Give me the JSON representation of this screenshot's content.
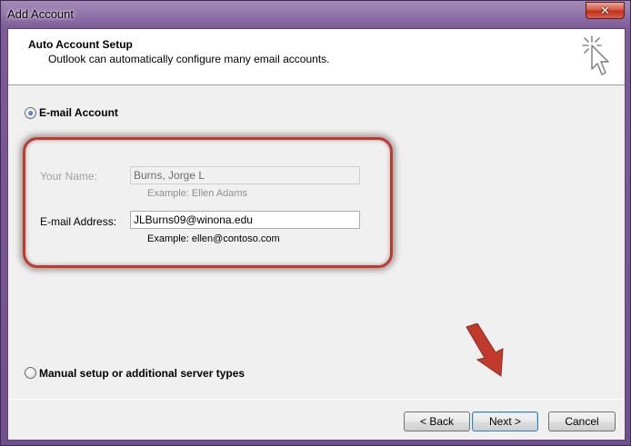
{
  "window": {
    "title": "Add Account",
    "close_glyph": "✕"
  },
  "header": {
    "title": "Auto Account Setup",
    "subtitle": "Outlook can automatically configure many email accounts.",
    "icon": "cursor-click-icon"
  },
  "options": {
    "email_account_label": "E-mail Account",
    "email_account_selected": true,
    "manual_setup_label": "Manual setup or additional server types",
    "manual_setup_selected": false
  },
  "form": {
    "name_label": "Your Name:",
    "name_value": "Burns, Jorge L",
    "name_example": "Example: Ellen Adams",
    "email_label": "E-mail Address:",
    "email_value": "JLBurns09@winona.edu",
    "email_example": "Example: ellen@contoso.com"
  },
  "buttons": {
    "back": "< Back",
    "next": "Next >",
    "cancel": "Cancel"
  },
  "colors": {
    "annotation": "#c0392b",
    "frame": "#7d5c99"
  }
}
